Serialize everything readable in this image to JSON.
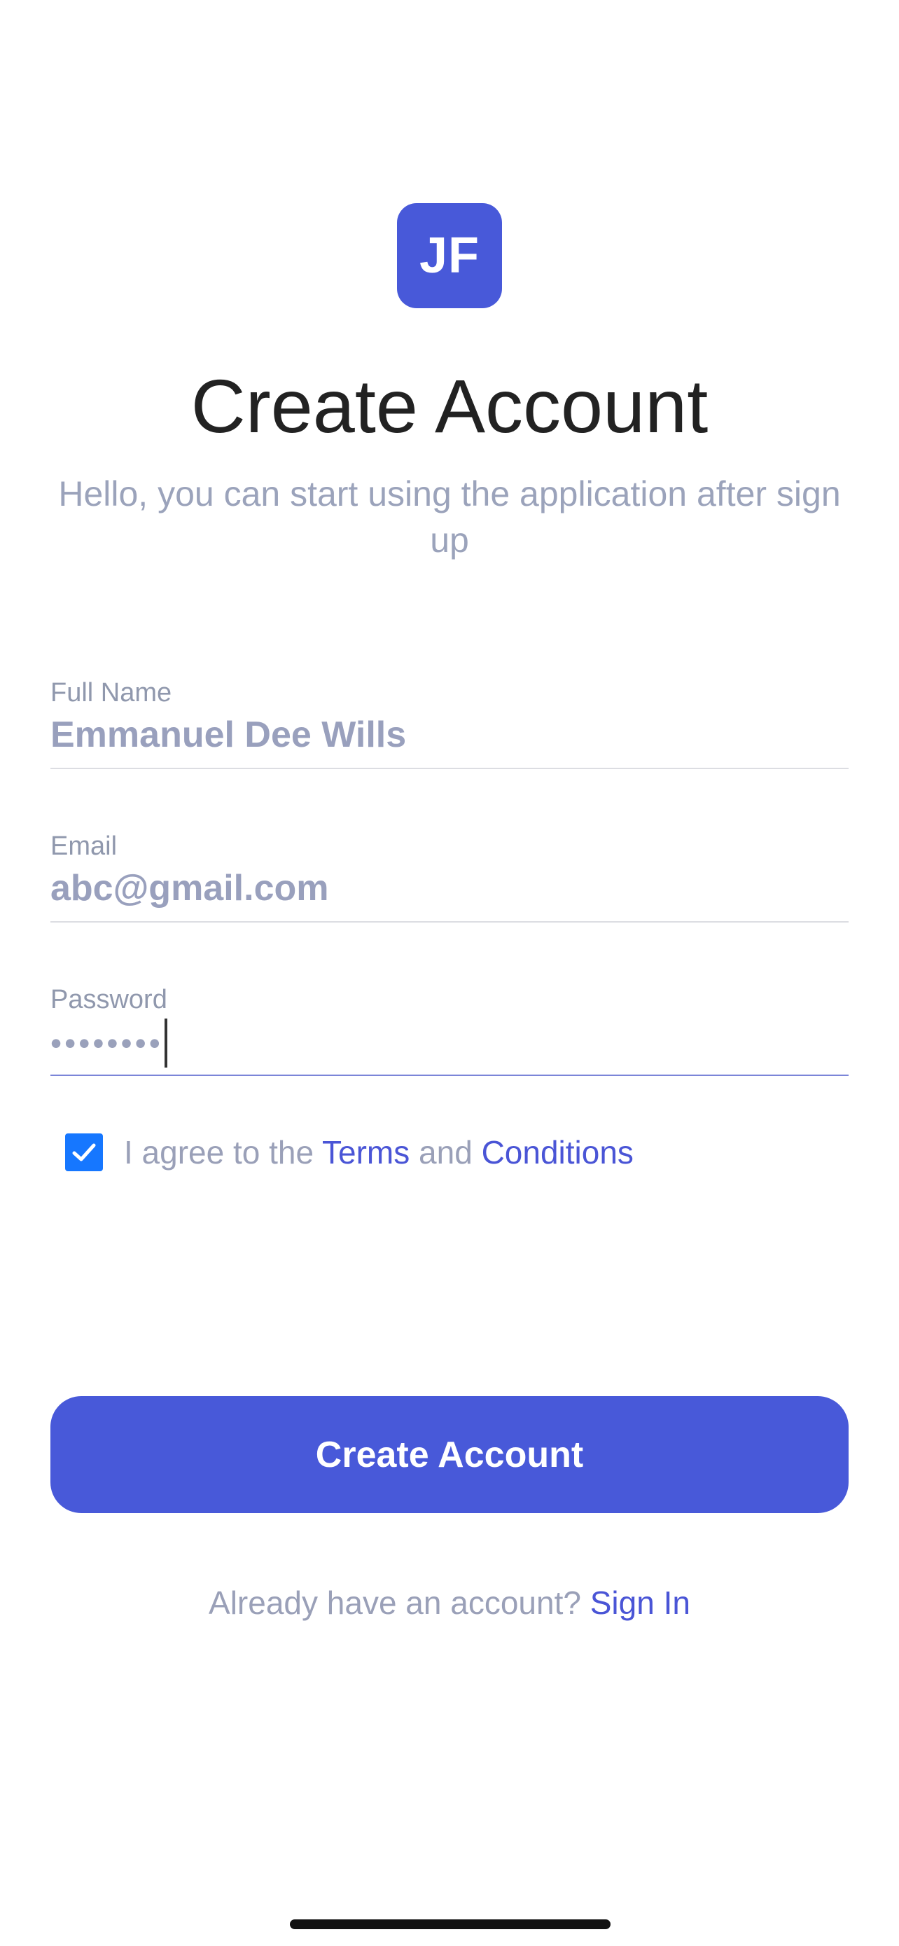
{
  "app": {
    "logo_text": "JF",
    "title": "Create Account",
    "subtitle": "Hello, you can start using the application after sign up"
  },
  "form": {
    "full_name": {
      "label": "Full Name",
      "value": "Emmanuel Dee Wills"
    },
    "email": {
      "label": "Email",
      "value": "abc@gmail.com"
    },
    "password": {
      "label": "Password",
      "masked_value": "••••••••",
      "focused": true
    }
  },
  "agreement": {
    "checked": true,
    "prefix": "I agree to the ",
    "terms_label": "Terms",
    "middle": " and ",
    "conditions_label": "Conditions"
  },
  "actions": {
    "create_account_label": "Create Account",
    "already_text": "Already have an account? ",
    "sign_in_label": "Sign In"
  },
  "colors": {
    "accent": "#4859d9",
    "link": "#4a55d6",
    "checkbox": "#1677ff",
    "muted_text": "#9aa0b8"
  },
  "icons": {
    "checkbox": "checkmark-icon"
  }
}
